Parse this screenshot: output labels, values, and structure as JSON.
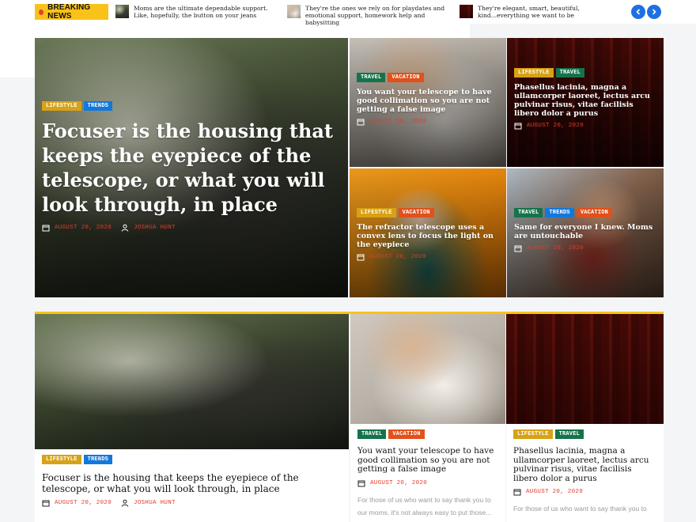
{
  "ticker": {
    "label": "BREAKING NEWS",
    "items": [
      {
        "text": "Moms are the ultimate dependable support. Like, hopefully, the button on your jeans"
      },
      {
        "text": "They're the ones we rely on for playdates and emotional support, homework help and babysitting"
      },
      {
        "text": "They're elegant, smart, beautiful, kind...everything we want to be"
      }
    ],
    "prev_icon": "chevron-left-icon",
    "next_icon": "chevron-right-icon"
  },
  "hero": {
    "main": {
      "tags": [
        "LIFESTYLE",
        "TRENDS"
      ],
      "title": "Focuser is the housing that keeps the eyepiece of the telescope, or what you will look through, in place",
      "date": "AUGUST 20, 2020",
      "author": "JOSHUA HUNT"
    },
    "tiles": [
      {
        "tags": [
          "TRAVEL",
          "VACATION"
        ],
        "title": "You want your telescope to have good collimation so you are not getting a false image",
        "date": "AUGUST 20, 2020"
      },
      {
        "tags": [
          "LIFESTYLE",
          "TRAVEL"
        ],
        "title": "Phasellus lacinia, magna a ullamcorper laoreet, lectus arcu pulvinar risus, vitae facilisis libero dolor a purus",
        "date": "AUGUST 20, 2020"
      },
      {
        "tags": [
          "LIFESTYLE",
          "VACATION"
        ],
        "title": "The refractor telescope uses a convex lens to focus the light on the eyepiece",
        "date": "AUGUST 20, 2020"
      },
      {
        "tags": [
          "TRAVEL",
          "TRENDS",
          "VACATION"
        ],
        "title": "Same for everyone I knew. Moms are untouchable",
        "date": "AUGUST 20, 2020"
      }
    ]
  },
  "cards": [
    {
      "tags": [
        "LIFESTYLE",
        "TRENDS"
      ],
      "title": "Focuser is the housing that keeps the eyepiece of the telescope, or what you will look through, in place",
      "date": "AUGUST 20, 2020",
      "author": "JOSHUA HUNT"
    },
    {
      "tags": [
        "TRAVEL",
        "VACATION"
      ],
      "title": "You want your telescope to have good collimation so you are not getting a false image",
      "date": "AUGUST 20, 2020",
      "excerpt": "For those of us who want to say thank you to our moms, it's not always easy to put those..."
    },
    {
      "tags": [
        "LIFESTYLE",
        "TRAVEL"
      ],
      "title": "Phasellus lacinia, magna a ullamcorper laoreet, lectus arcu pulvinar risus, vitae facilisis libero dolor a purus",
      "date": "AUGUST 20, 2020",
      "excerpt": "For those of us who want to say thank you to"
    }
  ],
  "colors": {
    "lifestyle": "#d7a215",
    "trends": "#1378db",
    "travel": "#15734b",
    "vacation": "#e0511b",
    "accent": "#f8c21b",
    "date": "#e43b2c"
  }
}
